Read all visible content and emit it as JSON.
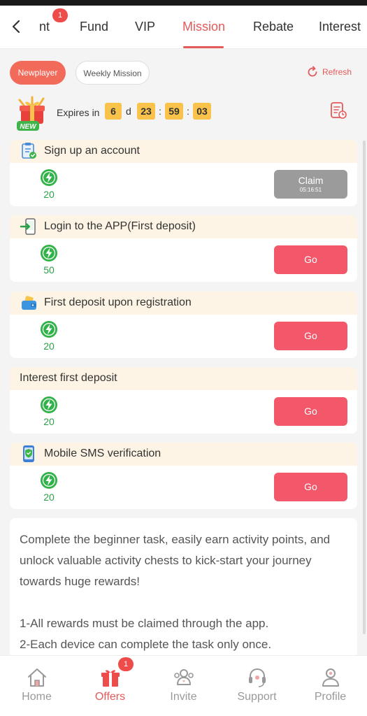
{
  "top_tabs": {
    "badge": "1",
    "items": [
      {
        "label": "nt"
      },
      {
        "label": "Fund"
      },
      {
        "label": "VIP"
      },
      {
        "label": "Mission"
      },
      {
        "label": "Rebate"
      },
      {
        "label": "Interest"
      }
    ],
    "active_index": 3
  },
  "mission_filters": {
    "newplayer": "Newplayer",
    "weekly": "Weekly Mission"
  },
  "refresh_label": "Refresh",
  "expires": {
    "label": "Expires in",
    "new_tag": "NEW",
    "days": "6",
    "day_unit": "d",
    "hours": "23",
    "minutes": "59",
    "seconds": "03",
    "separator": ":"
  },
  "tasks": [
    {
      "title": "Sign up an account",
      "points": "20",
      "button": "Claim",
      "button_sub": "05:16:51",
      "icon": "clipboard-check-icon"
    },
    {
      "title": "Login to the APP(First deposit)",
      "points": "50",
      "button": "Go",
      "icon": "login-app-icon"
    },
    {
      "title": "First deposit upon registration",
      "points": "20",
      "button": "Go",
      "icon": "wallet-icon"
    },
    {
      "title": "Interest first deposit",
      "points": "20",
      "button": "Go",
      "icon": ""
    },
    {
      "title": "Mobile SMS verification",
      "points": "20",
      "button": "Go",
      "icon": "phone-shield-icon"
    }
  ],
  "info": {
    "paragraph": "Complete the beginner task, easily earn activity points, and unlock valuable activity chests to kick-start your journey towards huge rewards!",
    "rule1": "1-All rewards must be claimed through the app.",
    "rule2": "2-Each device can complete the task only once."
  },
  "bottom_nav": {
    "items": [
      {
        "label": "Home",
        "icon": "home-icon"
      },
      {
        "label": "Offers",
        "icon": "gift-icon",
        "badge": "1"
      },
      {
        "label": "Invite",
        "icon": "invite-icon"
      },
      {
        "label": "Support",
        "icon": "headset-icon"
      },
      {
        "label": "Profile",
        "icon": "profile-icon"
      }
    ],
    "active_index": 1
  },
  "colors": {
    "accent": "#e55a5a",
    "go_button": "#f2586a",
    "claim_button": "#9b9b9b",
    "timer_box": "#f9c24a",
    "points_green": "#2aa147",
    "task_header": "#fdf4e5"
  }
}
